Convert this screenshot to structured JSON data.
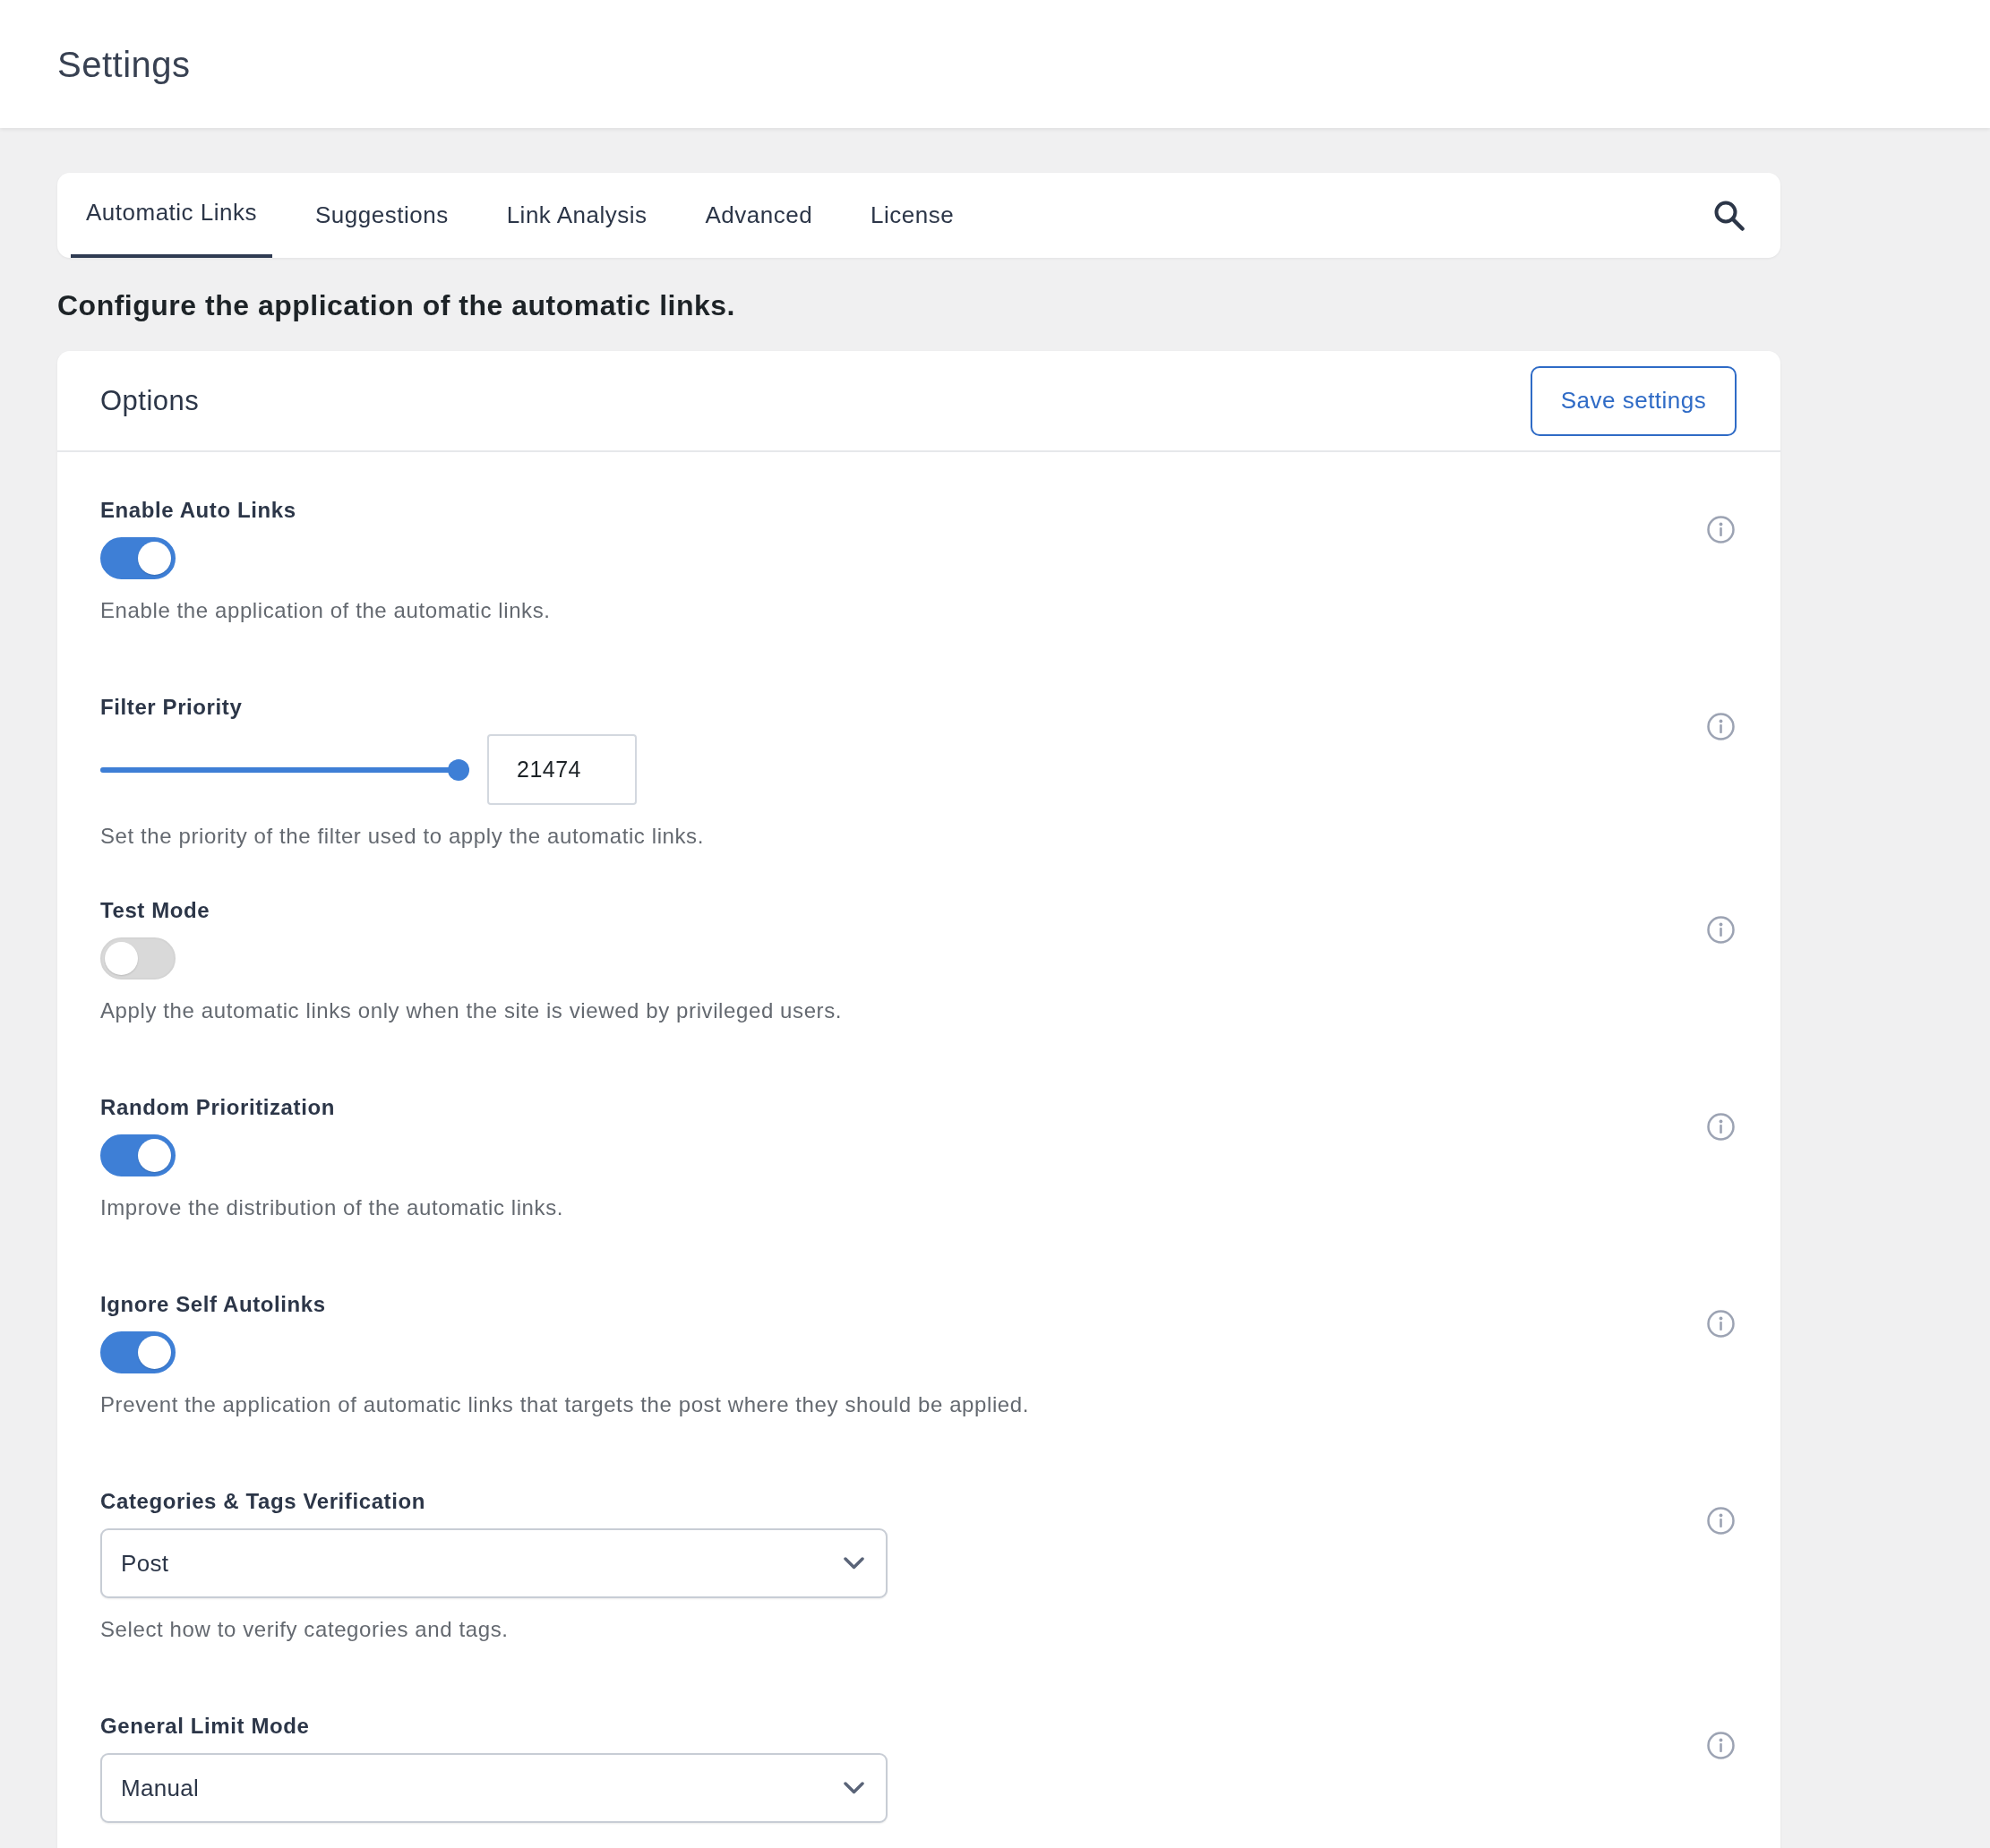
{
  "page": {
    "title": "Settings"
  },
  "tabs": [
    {
      "label": "Automatic Links",
      "selected": true
    },
    {
      "label": "Suggestions",
      "selected": false
    },
    {
      "label": "Link Analysis",
      "selected": false
    },
    {
      "label": "Advanced",
      "selected": false
    },
    {
      "label": "License",
      "selected": false
    }
  ],
  "heading": "Configure the application of the automatic links.",
  "options": {
    "title": "Options",
    "save_button": "Save settings",
    "settings": [
      {
        "kind": "toggle",
        "label": "Enable Auto Links",
        "on": true,
        "description": "Enable the application of the automatic links."
      },
      {
        "kind": "slider",
        "label": "Filter Priority",
        "level": 1,
        "value": "21474",
        "description": "Set the priority of the filter used to apply the automatic links."
      },
      {
        "kind": "toggle",
        "label": "Test Mode",
        "on": false,
        "description": "Apply the automatic links only when the site is viewed by privileged users."
      },
      {
        "kind": "toggle",
        "label": "Random Prioritization",
        "on": true,
        "description": "Improve the distribution of the automatic links."
      },
      {
        "kind": "toggle",
        "label": "Ignore Self Autolinks",
        "on": true,
        "description": "Prevent the application of automatic links that targets the post where they should be applied."
      },
      {
        "kind": "select",
        "label": "Categories & Tags Verification",
        "value": "Post",
        "description": "Select how to verify categories and tags."
      },
      {
        "kind": "select",
        "label": "General Limit Mode",
        "value": "Manual"
      }
    ]
  }
}
